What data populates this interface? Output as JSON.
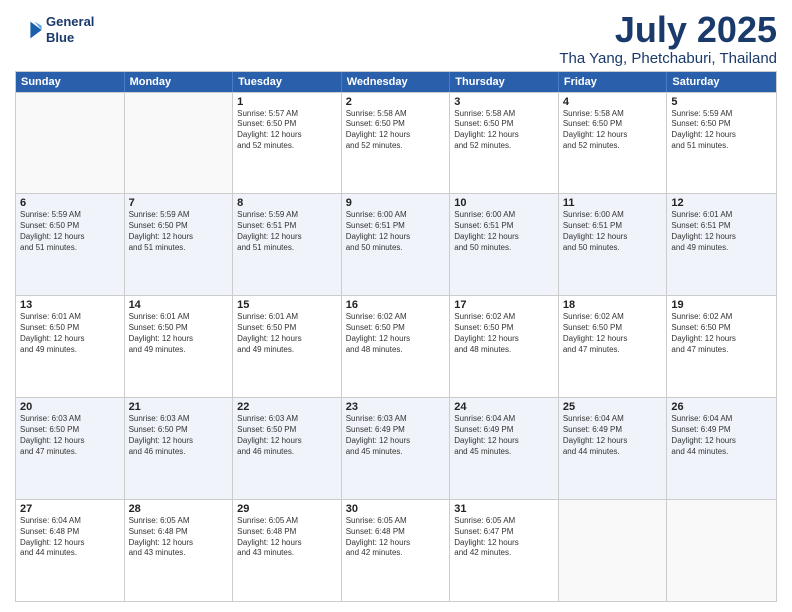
{
  "header": {
    "logo_line1": "General",
    "logo_line2": "Blue",
    "title": "July 2025",
    "location": "Tha Yang, Phetchaburi, Thailand"
  },
  "days_of_week": [
    "Sunday",
    "Monday",
    "Tuesday",
    "Wednesday",
    "Thursday",
    "Friday",
    "Saturday"
  ],
  "weeks": [
    {
      "alt": false,
      "cells": [
        {
          "day": "",
          "info": ""
        },
        {
          "day": "",
          "info": ""
        },
        {
          "day": "1",
          "info": "Sunrise: 5:57 AM\nSunset: 6:50 PM\nDaylight: 12 hours\nand 52 minutes."
        },
        {
          "day": "2",
          "info": "Sunrise: 5:58 AM\nSunset: 6:50 PM\nDaylight: 12 hours\nand 52 minutes."
        },
        {
          "day": "3",
          "info": "Sunrise: 5:58 AM\nSunset: 6:50 PM\nDaylight: 12 hours\nand 52 minutes."
        },
        {
          "day": "4",
          "info": "Sunrise: 5:58 AM\nSunset: 6:50 PM\nDaylight: 12 hours\nand 52 minutes."
        },
        {
          "day": "5",
          "info": "Sunrise: 5:59 AM\nSunset: 6:50 PM\nDaylight: 12 hours\nand 51 minutes."
        }
      ]
    },
    {
      "alt": true,
      "cells": [
        {
          "day": "6",
          "info": "Sunrise: 5:59 AM\nSunset: 6:50 PM\nDaylight: 12 hours\nand 51 minutes."
        },
        {
          "day": "7",
          "info": "Sunrise: 5:59 AM\nSunset: 6:50 PM\nDaylight: 12 hours\nand 51 minutes."
        },
        {
          "day": "8",
          "info": "Sunrise: 5:59 AM\nSunset: 6:51 PM\nDaylight: 12 hours\nand 51 minutes."
        },
        {
          "day": "9",
          "info": "Sunrise: 6:00 AM\nSunset: 6:51 PM\nDaylight: 12 hours\nand 50 minutes."
        },
        {
          "day": "10",
          "info": "Sunrise: 6:00 AM\nSunset: 6:51 PM\nDaylight: 12 hours\nand 50 minutes."
        },
        {
          "day": "11",
          "info": "Sunrise: 6:00 AM\nSunset: 6:51 PM\nDaylight: 12 hours\nand 50 minutes."
        },
        {
          "day": "12",
          "info": "Sunrise: 6:01 AM\nSunset: 6:51 PM\nDaylight: 12 hours\nand 49 minutes."
        }
      ]
    },
    {
      "alt": false,
      "cells": [
        {
          "day": "13",
          "info": "Sunrise: 6:01 AM\nSunset: 6:50 PM\nDaylight: 12 hours\nand 49 minutes."
        },
        {
          "day": "14",
          "info": "Sunrise: 6:01 AM\nSunset: 6:50 PM\nDaylight: 12 hours\nand 49 minutes."
        },
        {
          "day": "15",
          "info": "Sunrise: 6:01 AM\nSunset: 6:50 PM\nDaylight: 12 hours\nand 49 minutes."
        },
        {
          "day": "16",
          "info": "Sunrise: 6:02 AM\nSunset: 6:50 PM\nDaylight: 12 hours\nand 48 minutes."
        },
        {
          "day": "17",
          "info": "Sunrise: 6:02 AM\nSunset: 6:50 PM\nDaylight: 12 hours\nand 48 minutes."
        },
        {
          "day": "18",
          "info": "Sunrise: 6:02 AM\nSunset: 6:50 PM\nDaylight: 12 hours\nand 47 minutes."
        },
        {
          "day": "19",
          "info": "Sunrise: 6:02 AM\nSunset: 6:50 PM\nDaylight: 12 hours\nand 47 minutes."
        }
      ]
    },
    {
      "alt": true,
      "cells": [
        {
          "day": "20",
          "info": "Sunrise: 6:03 AM\nSunset: 6:50 PM\nDaylight: 12 hours\nand 47 minutes."
        },
        {
          "day": "21",
          "info": "Sunrise: 6:03 AM\nSunset: 6:50 PM\nDaylight: 12 hours\nand 46 minutes."
        },
        {
          "day": "22",
          "info": "Sunrise: 6:03 AM\nSunset: 6:50 PM\nDaylight: 12 hours\nand 46 minutes."
        },
        {
          "day": "23",
          "info": "Sunrise: 6:03 AM\nSunset: 6:49 PM\nDaylight: 12 hours\nand 45 minutes."
        },
        {
          "day": "24",
          "info": "Sunrise: 6:04 AM\nSunset: 6:49 PM\nDaylight: 12 hours\nand 45 minutes."
        },
        {
          "day": "25",
          "info": "Sunrise: 6:04 AM\nSunset: 6:49 PM\nDaylight: 12 hours\nand 44 minutes."
        },
        {
          "day": "26",
          "info": "Sunrise: 6:04 AM\nSunset: 6:49 PM\nDaylight: 12 hours\nand 44 minutes."
        }
      ]
    },
    {
      "alt": false,
      "cells": [
        {
          "day": "27",
          "info": "Sunrise: 6:04 AM\nSunset: 6:48 PM\nDaylight: 12 hours\nand 44 minutes."
        },
        {
          "day": "28",
          "info": "Sunrise: 6:05 AM\nSunset: 6:48 PM\nDaylight: 12 hours\nand 43 minutes."
        },
        {
          "day": "29",
          "info": "Sunrise: 6:05 AM\nSunset: 6:48 PM\nDaylight: 12 hours\nand 43 minutes."
        },
        {
          "day": "30",
          "info": "Sunrise: 6:05 AM\nSunset: 6:48 PM\nDaylight: 12 hours\nand 42 minutes."
        },
        {
          "day": "31",
          "info": "Sunrise: 6:05 AM\nSunset: 6:47 PM\nDaylight: 12 hours\nand 42 minutes."
        },
        {
          "day": "",
          "info": ""
        },
        {
          "day": "",
          "info": ""
        }
      ]
    }
  ]
}
